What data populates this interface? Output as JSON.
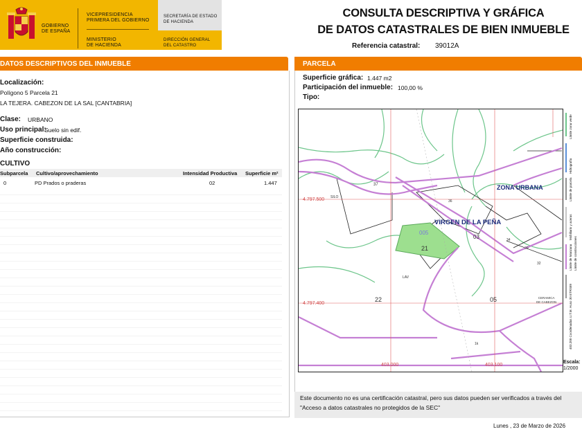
{
  "header": {
    "org_spain": [
      "GOBIERNO",
      "DE ESPAÑA"
    ],
    "vp": [
      "VICEPRESIDENCIA",
      "PRIMERA DEL GOBIERNO"
    ],
    "ministry": [
      "MINISTERIO",
      "DE HACIENDA"
    ],
    "secretaria": [
      "SECRETARÍA DE ESTADO",
      "DE HACIENDA"
    ],
    "direccion": [
      "DIRECCIÓN GENERAL",
      "DEL CATASTRO"
    ],
    "title_1": "CONSULTA DESCRIPTIVA Y GRÁFICA",
    "title_2": "DE DATOS CATASTRALES DE BIEN INMUEBLE",
    "ref_label": "Referencia catastral:",
    "ref_value": "39012A"
  },
  "colors": {
    "gold": "#f2b600",
    "orange": "#f07d00",
    "parcel_green": "#9ddf8f",
    "boundary_purple": "#c57fd4",
    "terrain_green": "#6cc58a",
    "red_axis": "#e05a5a"
  },
  "descriptivos": {
    "bar_title": "DATOS DESCRIPTIVOS DEL INMUEBLE",
    "loc_label": "Localización:",
    "loc_line1": "Polígono 5 Parcela 21",
    "loc_line2": "LA TEJERA. CABEZON DE LA SAL [CANTABRIA]",
    "clase_label": "Clase:",
    "clase_value": "URBANO",
    "uso_label": "Uso principal:",
    "uso_value": "Suelo sin edif.",
    "sup_label": "Superficie construida:",
    "anio_label": "Año construcción:",
    "cultivo_label": "CULTIVO",
    "table_headers": [
      "Subparcela",
      "Cultivo/aprovechamiento",
      "Intensidad Productiva",
      "Superficie m²"
    ],
    "table_rows": [
      [
        "0",
        "PD Prados o praderas",
        "02",
        "1.447"
      ]
    ]
  },
  "parcela": {
    "bar_title": "PARCELA",
    "sup_label": "Superficie gráfica:",
    "sup_value": "1.447 m2",
    "part_label": "Participación del inmueble:",
    "part_value": "100,00 %",
    "tipo_label": "Tipo:"
  },
  "map": {
    "zona_urbana": "ZONA URBANA",
    "virgen": "VIRGEN DE LA PEÑA",
    "parcel_labels": [
      "21",
      "005",
      "03",
      "22",
      "05",
      "37",
      "1k"
    ],
    "y1": "4.797.500",
    "y2": "4.797.400",
    "x1": "403.000",
    "x2": "403.100",
    "ceramica": [
      "CERAMICA",
      "DE CABEZON"
    ],
    "road_small": [
      "36",
      "34",
      "30",
      "32",
      "LAV",
      "SILO"
    ],
    "legend_lines": [
      "Límite zona verde",
      "Hidrografía",
      "Límite de parcela",
      "Mobiliario y aceras",
      "Límite de Manzana",
      "Límite de construcciones",
      "403.200 Coordenadas U.T.M. Huso 30 ETRS89"
    ],
    "escala_label": "Escala:",
    "escala_value": "1/2000"
  },
  "footer": {
    "note": "Este documento no es una certificación catastral, pero sus datos pueden ser verificados a través del \"Acceso a datos catastrales no protegidos de la SEC\"",
    "date": "Lunes , 23 de Marzo de 2026"
  }
}
